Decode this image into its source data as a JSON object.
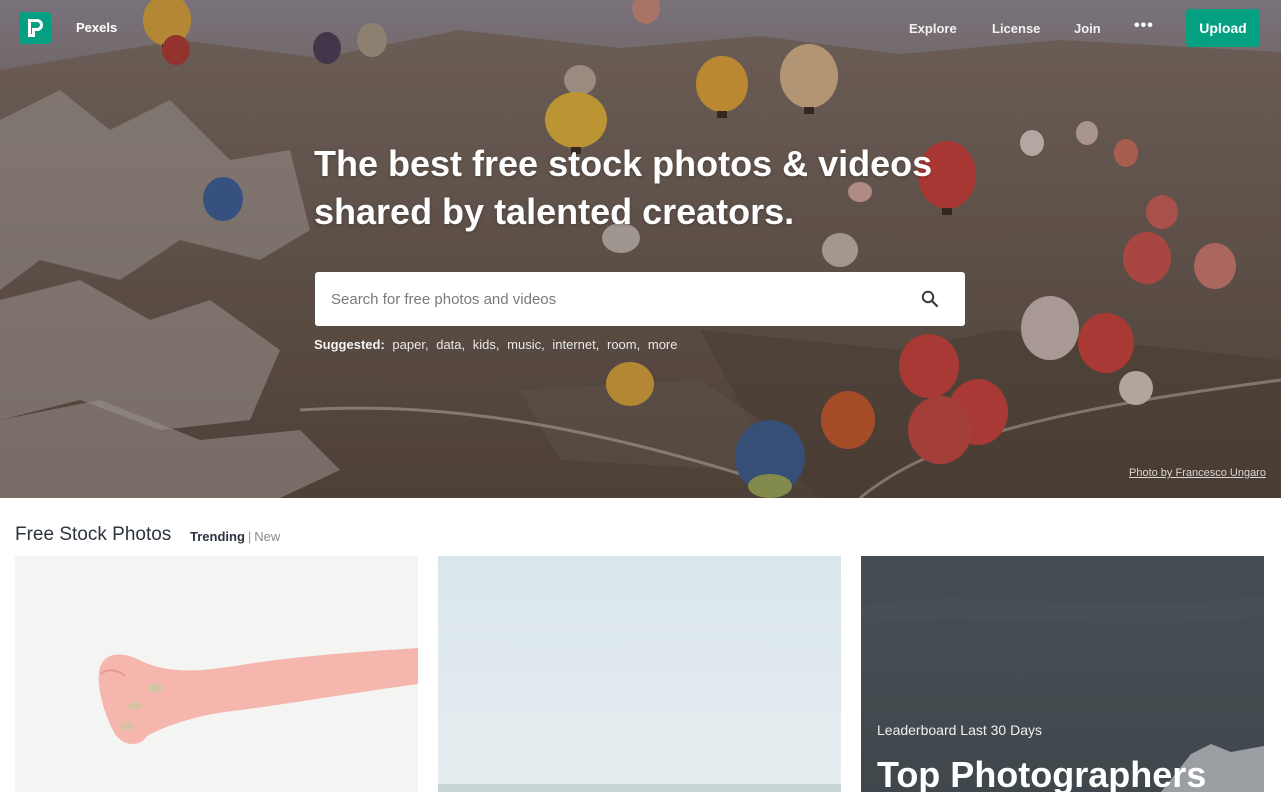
{
  "nav": {
    "brand": "Pexels",
    "links": [
      "Explore",
      "License",
      "Join"
    ],
    "more_icon": "more-dots-icon",
    "upload_label": "Upload"
  },
  "hero": {
    "headline_line1": "The best free stock photos & videos",
    "headline_line2": "shared by talented creators.",
    "search_placeholder": "Search for free photos and videos",
    "suggested_label": "Suggested:",
    "suggested": [
      "paper",
      "data",
      "kids",
      "music",
      "internet",
      "room",
      "more"
    ],
    "photo_credit": "Photo by Francesco Ungaro"
  },
  "section": {
    "title": "Free Stock Photos",
    "tab_active": "Trending",
    "tab_separator": "|",
    "tab_inactive": "New"
  },
  "leaderboard": {
    "label": "Leaderboard Last 30 Days",
    "title": "Top Photographers"
  },
  "colors": {
    "brand": "#05a081",
    "hero_bg": "#6c5d52",
    "text_dark": "#2c343e"
  }
}
